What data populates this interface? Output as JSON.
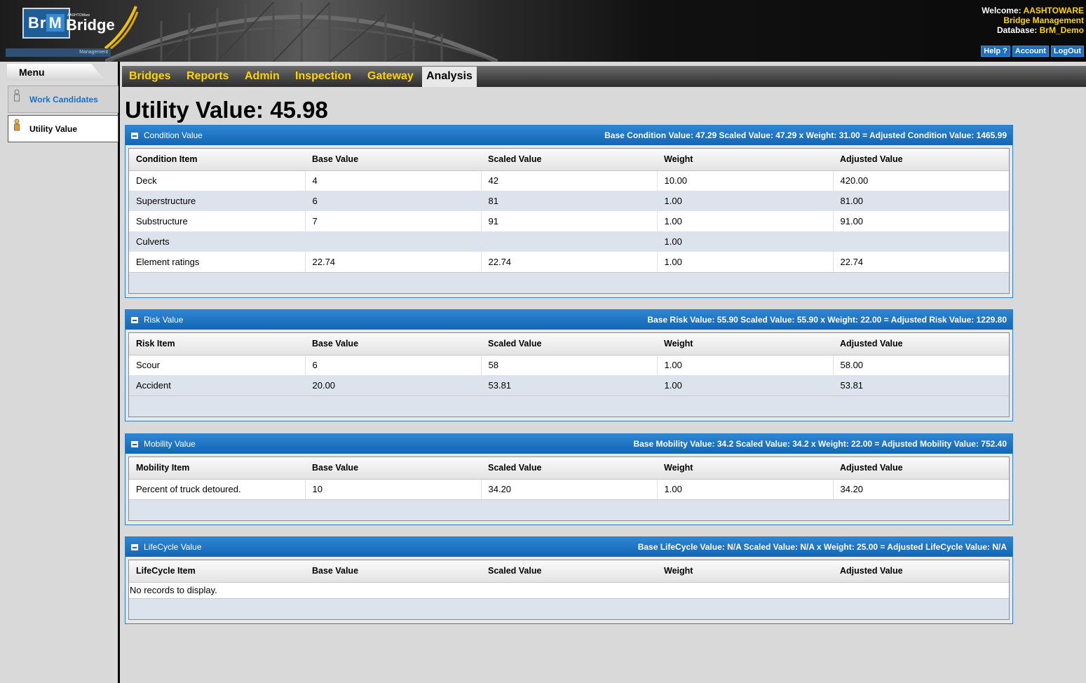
{
  "header": {
    "logo": {
      "brm_b": "Br",
      "brm_m": "M",
      "word": "Bridge",
      "tiny": "AASHTOWare",
      "sub": "Management"
    },
    "welcome_label": "Welcome:",
    "welcome_user": "AASHTOWARE",
    "welcome_app": "Bridge Management",
    "database_label": "Database:",
    "database_value": "BrM_Demo",
    "links": [
      "Help ?",
      "Account",
      "LogOut"
    ]
  },
  "sidebar": {
    "title": "Menu",
    "items": [
      {
        "label": "Work Candidates"
      },
      {
        "label": "Utility Value"
      }
    ]
  },
  "tabs": [
    "Bridges",
    "Reports",
    "Admin",
    "Inspection",
    "Gateway",
    "Analysis"
  ],
  "active_tab": "Analysis",
  "page": {
    "title": "Utility Value: 45.98"
  },
  "columns": {
    "base": "Base Value",
    "scaled": "Scaled Value",
    "weight": "Weight",
    "adjusted": "Adjusted Value"
  },
  "panels": {
    "condition": {
      "title": "Condition Value",
      "summary": "Base Condition Value: 47.29 Scaled Value: 47.29 x Weight: 31.00 = Adjusted Condition Value: 1465.99",
      "first_col": "Condition Item",
      "rows": [
        [
          "Deck",
          "4",
          "42",
          "10.00",
          "420.00"
        ],
        [
          "Superstructure",
          "6",
          "81",
          "1.00",
          "81.00"
        ],
        [
          "Substructure",
          "7",
          "91",
          "1.00",
          "91.00"
        ],
        [
          "Culverts",
          "",
          "",
          "1.00",
          ""
        ],
        [
          "Element ratings",
          "22.74",
          "22.74",
          "1.00",
          "22.74"
        ]
      ]
    },
    "risk": {
      "title": "Risk Value",
      "summary": "Base Risk Value: 55.90 Scaled Value: 55.90 x Weight: 22.00 = Adjusted Risk Value: 1229.80",
      "first_col": "Risk Item",
      "rows": [
        [
          "Scour",
          "6",
          "58",
          "1.00",
          "58.00"
        ],
        [
          "Accident",
          "20.00",
          "53.81",
          "1.00",
          "53.81"
        ]
      ]
    },
    "mobility": {
      "title": "Mobility Value",
      "summary": "Base Mobility Value: 34.2 Scaled Value: 34.2 x Weight: 22.00 = Adjusted Mobility Value: 752.40",
      "first_col": "Mobility Item",
      "rows": [
        [
          "Percent of truck detoured.",
          "10",
          "34.20",
          "1.00",
          "34.20"
        ]
      ]
    },
    "lifecycle": {
      "title": "LifeCycle Value",
      "summary": "Base LifeCycle Value: N/A Scaled Value: N/A x Weight: 25.00 = Adjusted LifeCycle Value: N/A",
      "first_col": "LifeCycle Item",
      "empty_text": "No records to display.",
      "rows": []
    }
  }
}
